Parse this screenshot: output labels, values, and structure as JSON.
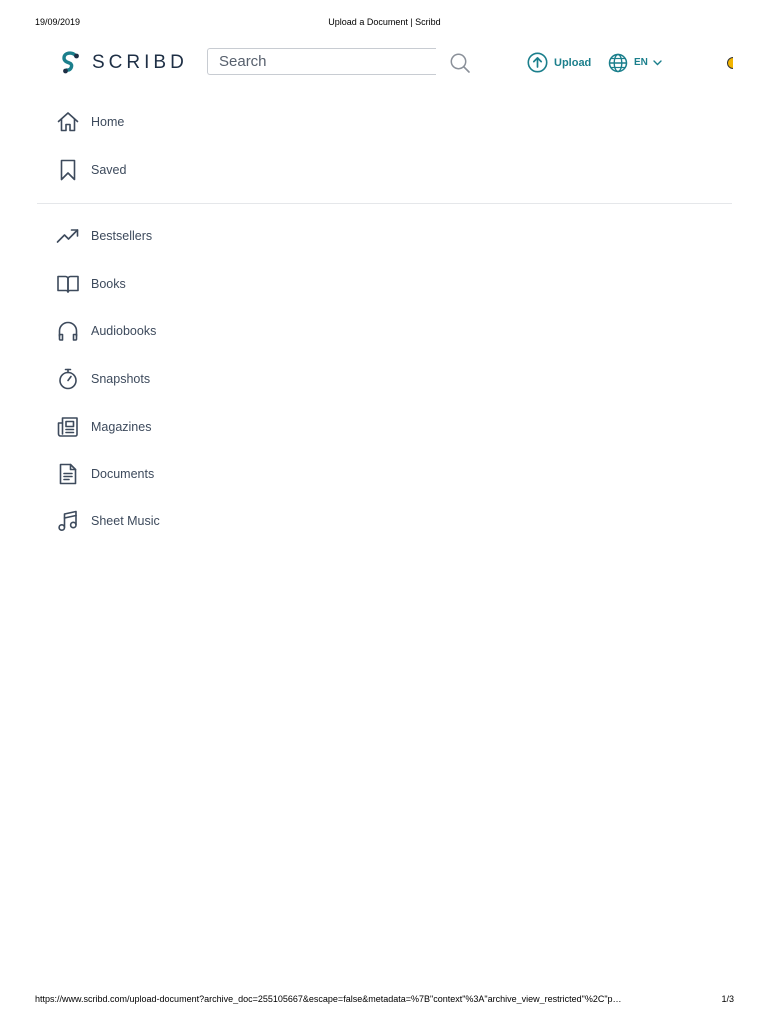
{
  "print": {
    "date": "19/09/2019",
    "title": "Upload a Document | Scribd",
    "url": "https://www.scribd.com/upload-document?archive_doc=255105667&escape=false&metadata=%7B\"context\"%3A\"archive_view_restricted\"%2C\"p…",
    "page": "1/3"
  },
  "header": {
    "logo_text": "SCRIBD",
    "search_placeholder": "Search",
    "upload_label": "Upload",
    "language_label": "EN"
  },
  "colors": {
    "accent": "#1b7f8c",
    "text": "#3d4a5c",
    "divider": "#e5e7ea"
  },
  "nav_primary": [
    {
      "label": "Home",
      "icon": "home-icon"
    },
    {
      "label": "Saved",
      "icon": "bookmark-icon"
    }
  ],
  "nav_categories": [
    {
      "label": "Bestsellers",
      "icon": "trending-up-icon"
    },
    {
      "label": "Books",
      "icon": "open-book-icon"
    },
    {
      "label": "Audiobooks",
      "icon": "headphones-icon"
    },
    {
      "label": "Snapshots",
      "icon": "stopwatch-icon"
    },
    {
      "label": "Magazines",
      "icon": "magazine-icon"
    },
    {
      "label": "Documents",
      "icon": "document-icon"
    },
    {
      "label": "Sheet Music",
      "icon": "music-note-icon"
    }
  ]
}
